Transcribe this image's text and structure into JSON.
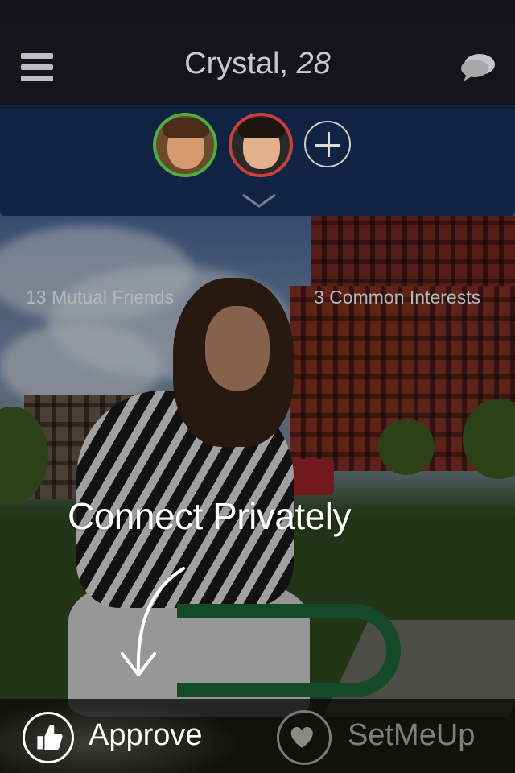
{
  "header": {
    "name": "Crystal,",
    "age": "28",
    "menu_icon": "hamburger-menu-icon",
    "chat_icon": "chat-bubble-icon"
  },
  "mutual": {
    "friends_label": "13 Mutual Friends",
    "interests_label": "3 Common Interests",
    "avatar_ring_colors": [
      "#4cae3f",
      "#c9403a"
    ],
    "add_icon": "plus-icon",
    "expand_icon": "chevron-down-icon"
  },
  "overlay": {
    "connect_label": "Connect Privately",
    "arrow_icon": "curved-arrow-down-icon"
  },
  "actions": {
    "approve_label": "Approve",
    "approve_icon": "thumbs-up-icon",
    "setmeup_label": "SetMeUp",
    "setmeup_icon": "heart-icon"
  }
}
